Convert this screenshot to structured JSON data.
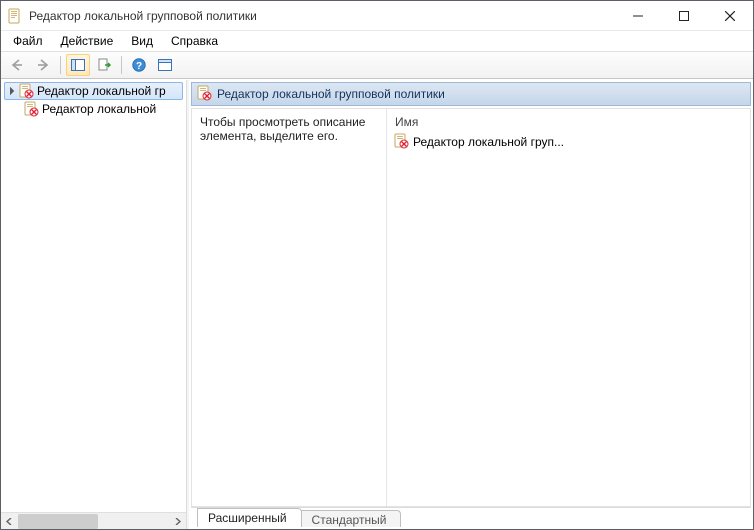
{
  "title": "Редактор локальной групповой политики",
  "menu": {
    "file": "Файл",
    "action": "Действие",
    "view": "Вид",
    "help": "Справка"
  },
  "tree": {
    "root": "Редактор локальной гр",
    "child": "Редактор локальной"
  },
  "pane": {
    "header": "Редактор локальной групповой политики",
    "description": "Чтобы просмотреть описание элемента, выделите его.",
    "column_name": "Имя",
    "item": "Редактор локальной груп..."
  },
  "tabs": {
    "extended": "Расширенный",
    "standard": "Стандартный"
  }
}
